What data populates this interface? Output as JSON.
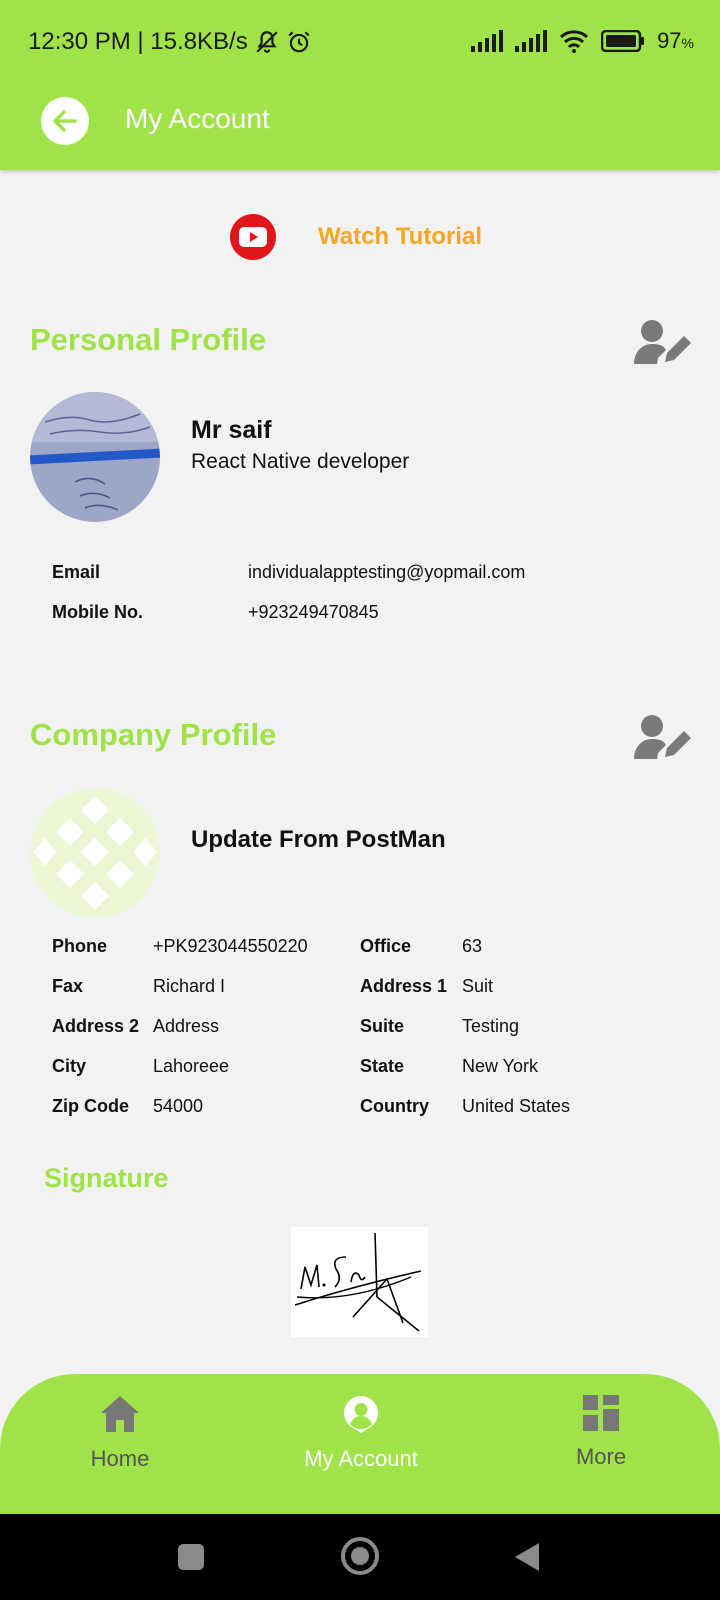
{
  "status_bar": {
    "time_speed": "12:30 PM | 15.8KB/s",
    "battery_percent": "97",
    "battery_unit": "%"
  },
  "header": {
    "title": "My Account"
  },
  "tutorial": {
    "label": "Watch Tutorial"
  },
  "personal": {
    "section_title": "Personal Profile",
    "name": "Mr saif",
    "role": "React Native developer",
    "fields": [
      {
        "label": "Email",
        "value": "individualapptesting@yopmail.com"
      },
      {
        "label": "Mobile No.",
        "value": "+923249470845"
      }
    ]
  },
  "company": {
    "section_title": "Company Profile",
    "name": "Update From PostMan",
    "left_fields": [
      {
        "label": "Phone",
        "value": "+PK923044550220"
      },
      {
        "label": "Fax",
        "value": "Richard I"
      },
      {
        "label": "Address 2",
        "value": "Address"
      },
      {
        "label": "City",
        "value": "Lahoreee"
      },
      {
        "label": "Zip Code",
        "value": "54000"
      }
    ],
    "right_fields": [
      {
        "label": "Office",
        "value": "63"
      },
      {
        "label": "Address 1",
        "value": "Suit"
      },
      {
        "label": "Suite",
        "value": "Testing"
      },
      {
        "label": "State",
        "value": "New York"
      },
      {
        "label": "Country",
        "value": "United States"
      }
    ]
  },
  "signature": {
    "title": "Signature"
  },
  "nav": {
    "items": [
      {
        "label": "Home",
        "icon": "home-icon"
      },
      {
        "label": "My Account",
        "icon": "account-icon",
        "active": true
      },
      {
        "label": "More",
        "icon": "grid-icon"
      }
    ]
  },
  "colors": {
    "brand_green": "#a0e348",
    "tutorial_orange": "#f6a623",
    "youtube_red": "#e0161a"
  }
}
